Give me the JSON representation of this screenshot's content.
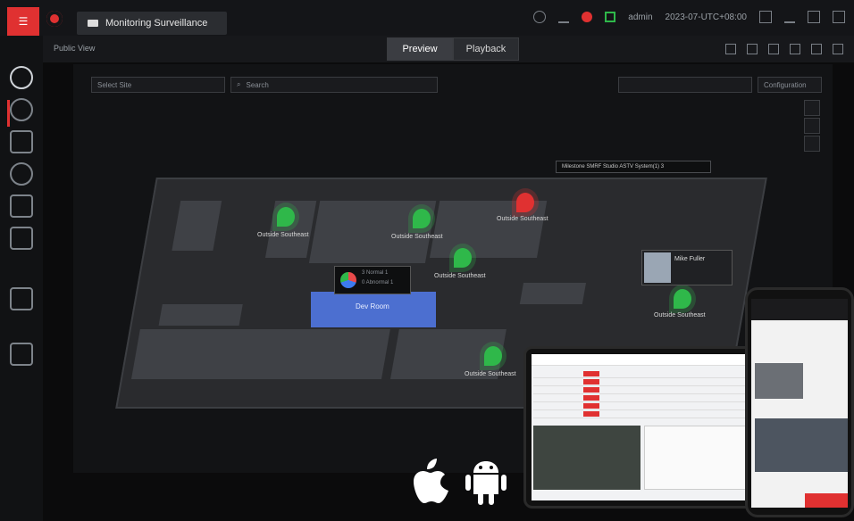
{
  "window": {
    "tab_title": "Monitoring Surveillance"
  },
  "header": {
    "user": "admin",
    "datetime": "2023-07-UTC+08:00"
  },
  "toolbar": {
    "view_name": "Public View",
    "tabs": [
      "Preview",
      "Playback"
    ],
    "active_tab": "Preview"
  },
  "map": {
    "controls": {
      "select_placeholder": "Select Site",
      "search_placeholder": "Search",
      "configuration": "Configuration"
    },
    "tooltip": "Milestone SMRF Studio ASTV System(1) 3",
    "rooms": {
      "blue_room_label": "Dev Room"
    },
    "pins": [
      {
        "label": "Outside Southeast",
        "status": "green"
      },
      {
        "label": "Outside Southeast",
        "status": "green"
      },
      {
        "label": "Outside Southeast",
        "status": "green"
      },
      {
        "label": "Outside Southeast",
        "status": "red"
      },
      {
        "label": "Outside Southeast",
        "status": "green"
      },
      {
        "label": "Outside Southeast",
        "status": "green"
      }
    ],
    "popover": {
      "line1": "3 Normal  1",
      "line2": "0 Abnormal 1"
    },
    "profile": {
      "name": "Mike Fuller"
    }
  },
  "devices": {
    "apple_icon": "apple-icon",
    "android_icon": "android-icon"
  },
  "colors": {
    "accent": "#e03131",
    "green": "#2fb84a",
    "blue": "#4c6fd0"
  }
}
